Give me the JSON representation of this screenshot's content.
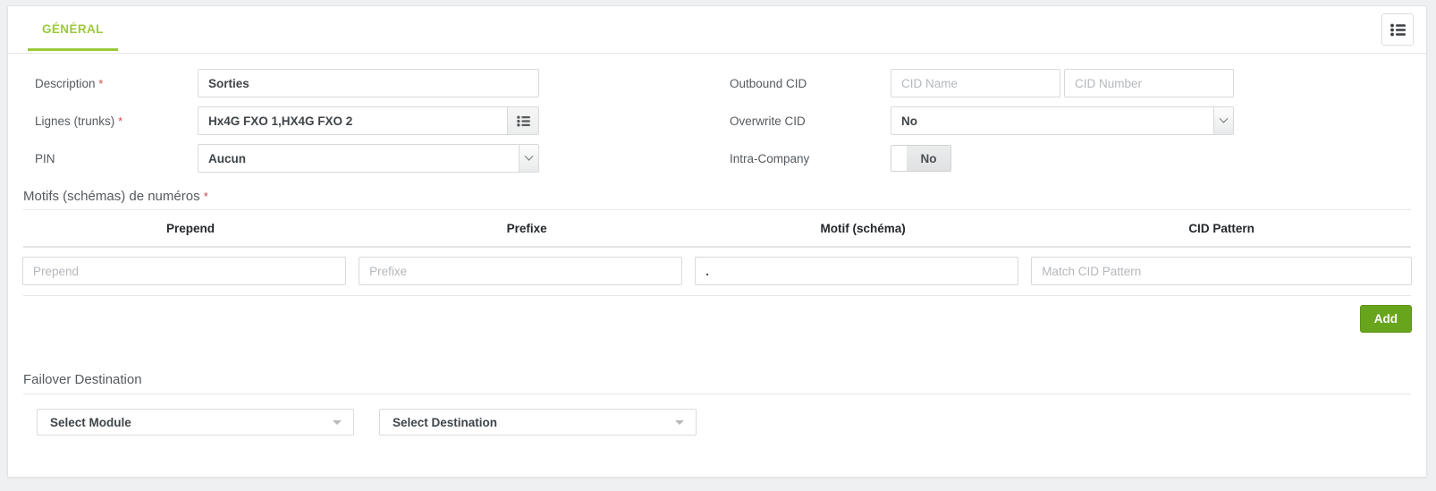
{
  "tabs": [
    {
      "label": "GÉNÉRAL",
      "active": true
    }
  ],
  "toolbar": {
    "list_button_icon": "list-icon"
  },
  "form": {
    "left": {
      "description": {
        "label": "Description",
        "required": "*",
        "value": "Sorties"
      },
      "trunks": {
        "label": "Lignes (trunks)",
        "required": "*",
        "value": "Hx4G FXO 1,HX4G FXO 2",
        "addon_icon": "list-icon"
      },
      "pin": {
        "label": "PIN",
        "value": "Aucun"
      }
    },
    "right": {
      "outbound_cid": {
        "label": "Outbound CID",
        "name_placeholder": "CID Name",
        "name_value": "",
        "number_placeholder": "CID Number",
        "number_value": ""
      },
      "overwrite_cid": {
        "label": "Overwrite CID",
        "value": "No"
      },
      "intra_company": {
        "label": "Intra-Company",
        "value": "No"
      }
    }
  },
  "patterns": {
    "title": "Motifs (schémas) de numéros",
    "required": "*",
    "headers": [
      "Prepend",
      "Prefixe",
      "Motif (schéma)",
      "CID Pattern"
    ],
    "rows": [
      {
        "prepend": {
          "value": "",
          "placeholder": "Prepend"
        },
        "prefixe": {
          "value": "",
          "placeholder": "Prefixe"
        },
        "motif": {
          "value": ".",
          "placeholder": ""
        },
        "cid_pattern": {
          "value": "",
          "placeholder": "Match CID Pattern"
        }
      }
    ],
    "add_label": "Add"
  },
  "failover": {
    "title": "Failover Destination",
    "module": "Select Module",
    "destination": "Select Destination"
  },
  "colors": {
    "accent_green": "#9cc93b",
    "button_green": "#68a51c",
    "required_red": "#cf4b4b",
    "label_gray": "#555a5f"
  }
}
